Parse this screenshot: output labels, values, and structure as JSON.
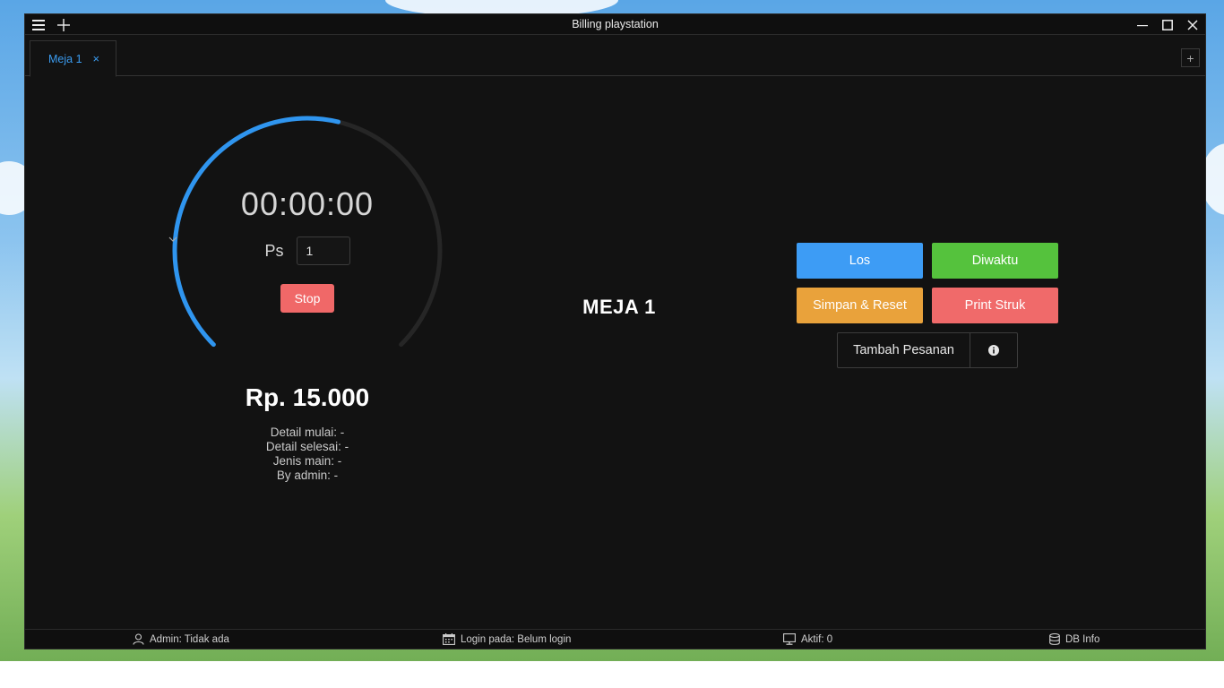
{
  "window": {
    "title": "Billing playstation"
  },
  "tabs": [
    {
      "label": "Meja 1",
      "active": true
    }
  ],
  "tab_close_glyph": "×",
  "tab_add_glyph": "+",
  "timer": {
    "time": "00:00:00",
    "ps_label": "Ps",
    "ps_selected": "1",
    "stop_label": "Stop",
    "progress_fraction": 0.55
  },
  "price": "Rp. 15.000",
  "details": {
    "mulai": "Detail mulai: -",
    "selesai": "Detail selesai: -",
    "jenis": "Jenis main: -",
    "admin": "By admin: -"
  },
  "table_name": "MEJA 1",
  "actions": {
    "los": "Los",
    "diwaktu": "Diwaktu",
    "simpan_reset": "Simpan & Reset",
    "print_struk": "Print Struk",
    "tambah_pesanan": "Tambah Pesanan"
  },
  "status": {
    "admin": "Admin: Tidak ada",
    "login": "Login pada: Belum login",
    "aktif": "Aktif: 0",
    "db": "DB Info"
  },
  "colors": {
    "accent": "#3b9cf0",
    "los": "#3d9cf5",
    "diwaktu": "#55c23d",
    "simpan": "#e9a23b",
    "print": "#f06a6a",
    "stop": "#f06868",
    "background": "#121212"
  },
  "icons": {
    "menu": "hamburger-icon",
    "new": "plus-icon",
    "minimize": "minimize-icon",
    "maximize": "maximize-icon",
    "close": "close-icon",
    "info": "info-icon",
    "user": "user-icon",
    "calendar": "calendar-icon",
    "monitor": "monitor-icon",
    "database": "database-icon"
  }
}
